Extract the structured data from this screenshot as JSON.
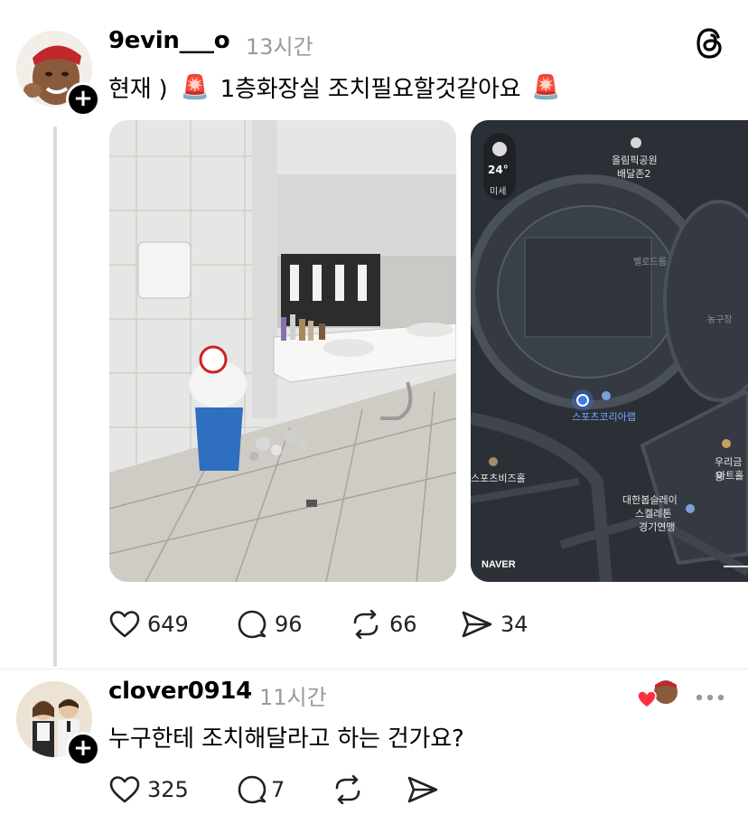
{
  "post": {
    "username": "9evin___o",
    "time": "13시간",
    "text_prefix": "현재 )",
    "text_main": "1층화장실 조치필요할것같아요",
    "siren_emoji": "🚨",
    "map": {
      "weather_temp": "24°",
      "weather_label": "미세",
      "poi_park": "올림픽공원",
      "poi_park_sub": "배달존2",
      "poi_velodrome": "벨로드롬",
      "poi_basketball": "농구장",
      "poi_current": "스포츠코리아랩",
      "poi_left": "스포츠비즈홀",
      "poi_right_1": "우리금융",
      "poi_right_2": "아트홀",
      "poi_bottom_1": "대한봅슬레이",
      "poi_bottom_2": "스켈레톤",
      "poi_bottom_3": "경기연맹",
      "brand": "NAVER"
    },
    "actions": {
      "likes": "649",
      "comments": "96",
      "reposts": "66",
      "shares": "34"
    }
  },
  "reply": {
    "username": "clover0914",
    "time": "11시간",
    "text": "누구한테 조치해달라고 하는 건가요?",
    "actions": {
      "likes": "325",
      "comments": "7"
    }
  },
  "colors": {
    "heart_red": "#ff3040",
    "map_bg": "#2b2f36",
    "location_blue": "#3d7cf2"
  }
}
